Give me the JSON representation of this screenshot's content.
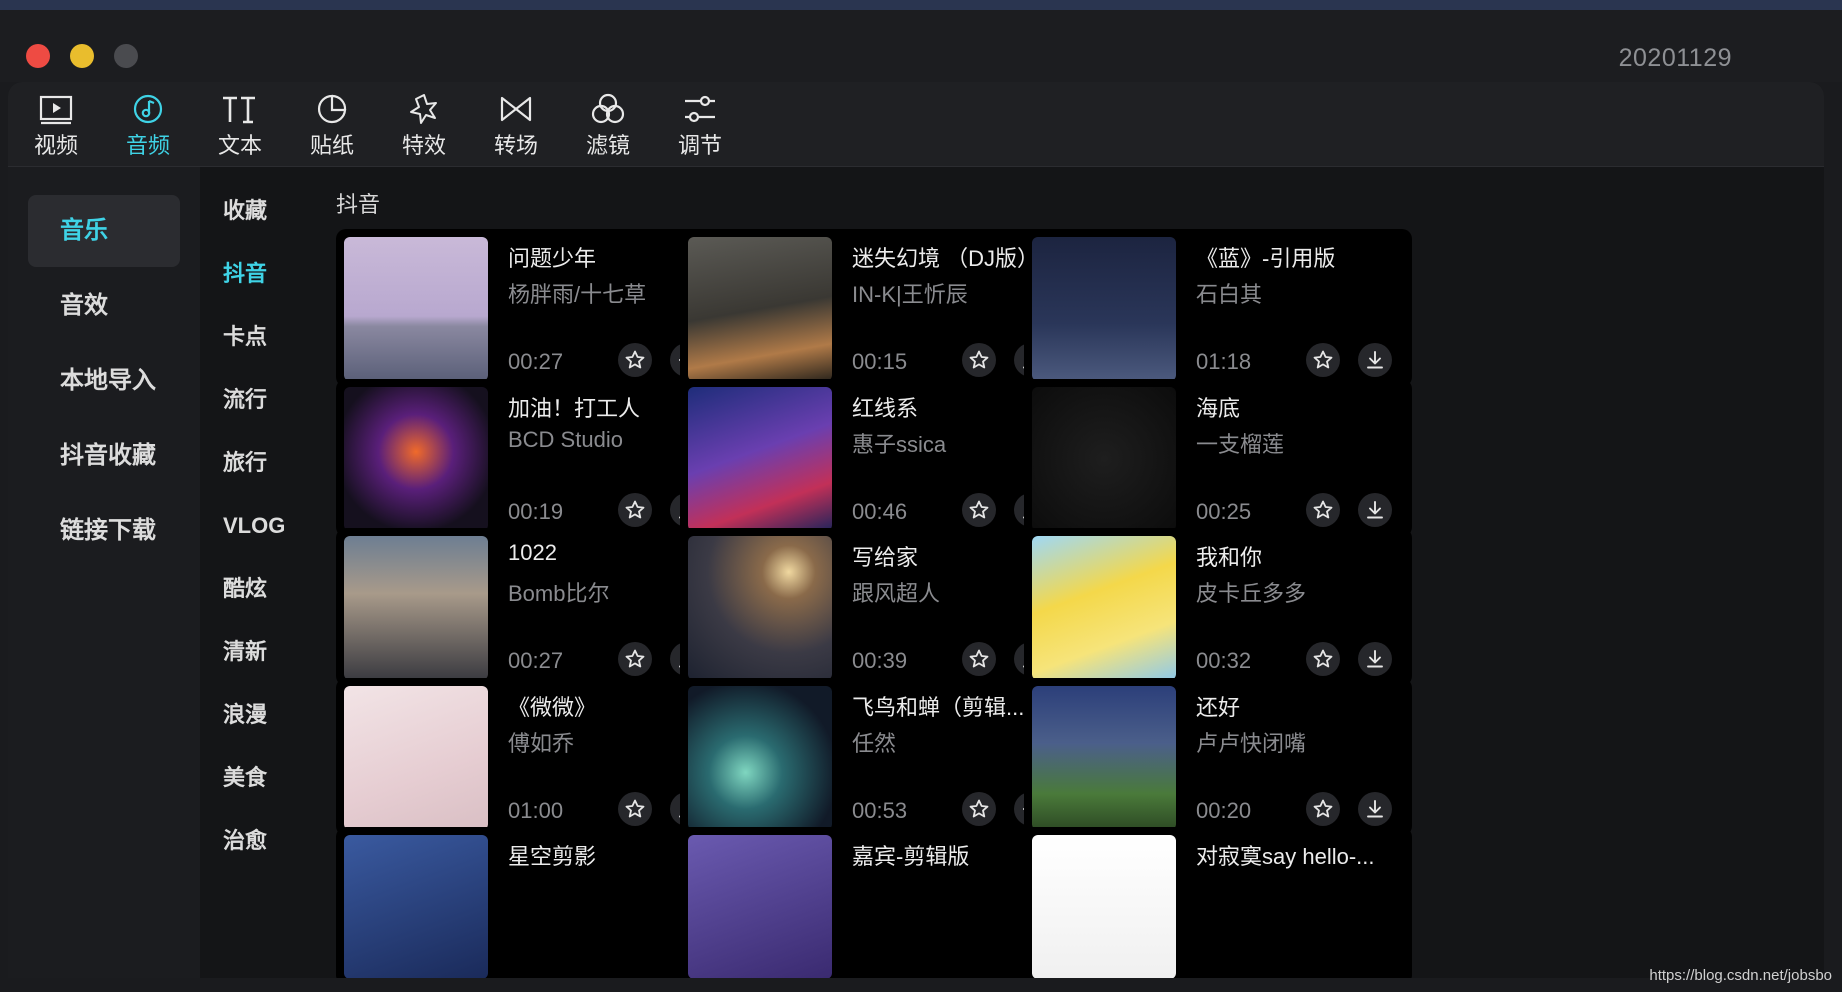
{
  "window": {
    "title": "20201129"
  },
  "toolbar": {
    "tabs": [
      {
        "label": "视频",
        "icon": "video-icon"
      },
      {
        "label": "音频",
        "icon": "audio-icon",
        "active": true
      },
      {
        "label": "文本",
        "icon": "text-icon"
      },
      {
        "label": "贴纸",
        "icon": "sticker-icon"
      },
      {
        "label": "特效",
        "icon": "effects-icon"
      },
      {
        "label": "转场",
        "icon": "transition-icon"
      },
      {
        "label": "滤镜",
        "icon": "filter-icon"
      },
      {
        "label": "调节",
        "icon": "adjust-icon"
      }
    ],
    "accent_color": "#3fd3e6"
  },
  "sidebar": {
    "items": [
      "音乐",
      "音效",
      "本地导入",
      "抖音收藏",
      "链接下载"
    ],
    "active_index": 0
  },
  "categories": {
    "items": [
      "收藏",
      "抖音",
      "卡点",
      "流行",
      "旅行",
      "VLOG",
      "酷炫",
      "清新",
      "浪漫",
      "美食",
      "治愈"
    ],
    "active_index": 1
  },
  "section": {
    "title": "抖音"
  },
  "tracks": [
    {
      "title": "问题少年",
      "artist": "杨胖雨/十七草",
      "duration": "00:27",
      "action": "add-icon"
    },
    {
      "title": "迷失幻境 （DJ版）",
      "artist": "IN-K|王忻辰",
      "duration": "00:15",
      "action": "download-icon"
    },
    {
      "title": "《蓝》-引用版",
      "artist": "石白其",
      "duration": "01:18",
      "action": "download-icon"
    },
    {
      "title": "加油！打工人",
      "artist": "BCD Studio",
      "duration": "00:19",
      "action": "download-icon"
    },
    {
      "title": "红线系",
      "artist": "惠子ssica",
      "duration": "00:46",
      "action": "download-icon"
    },
    {
      "title": "海底",
      "artist": "一支榴莲",
      "duration": "00:25",
      "action": "download-icon"
    },
    {
      "title": "1022",
      "artist": "Bomb比尔",
      "duration": "00:27",
      "action": "download-icon"
    },
    {
      "title": "写给家",
      "artist": "跟风超人",
      "duration": "00:39",
      "action": "download-icon"
    },
    {
      "title": "我和你",
      "artist": "皮卡丘多多",
      "duration": "00:32",
      "action": "download-icon"
    },
    {
      "title": "《微微》",
      "artist": "傅如乔",
      "duration": "01:00",
      "action": "download-icon"
    },
    {
      "title": "飞鸟和蝉（剪辑...",
      "artist": "任然",
      "duration": "00:53",
      "action": "add-icon"
    },
    {
      "title": "还好",
      "artist": "卢卢快闭嘴",
      "duration": "00:20",
      "action": "download-icon"
    },
    {
      "title": "星空剪影",
      "artist": "",
      "duration": "",
      "action": ""
    },
    {
      "title": "嘉宾-剪辑版",
      "artist": "",
      "duration": "",
      "action": ""
    },
    {
      "title": "对寂寞say hello-...",
      "artist": "",
      "duration": "",
      "action": ""
    }
  ],
  "footer": {
    "watermark": "https://blog.csdn.net/jobsbo"
  }
}
